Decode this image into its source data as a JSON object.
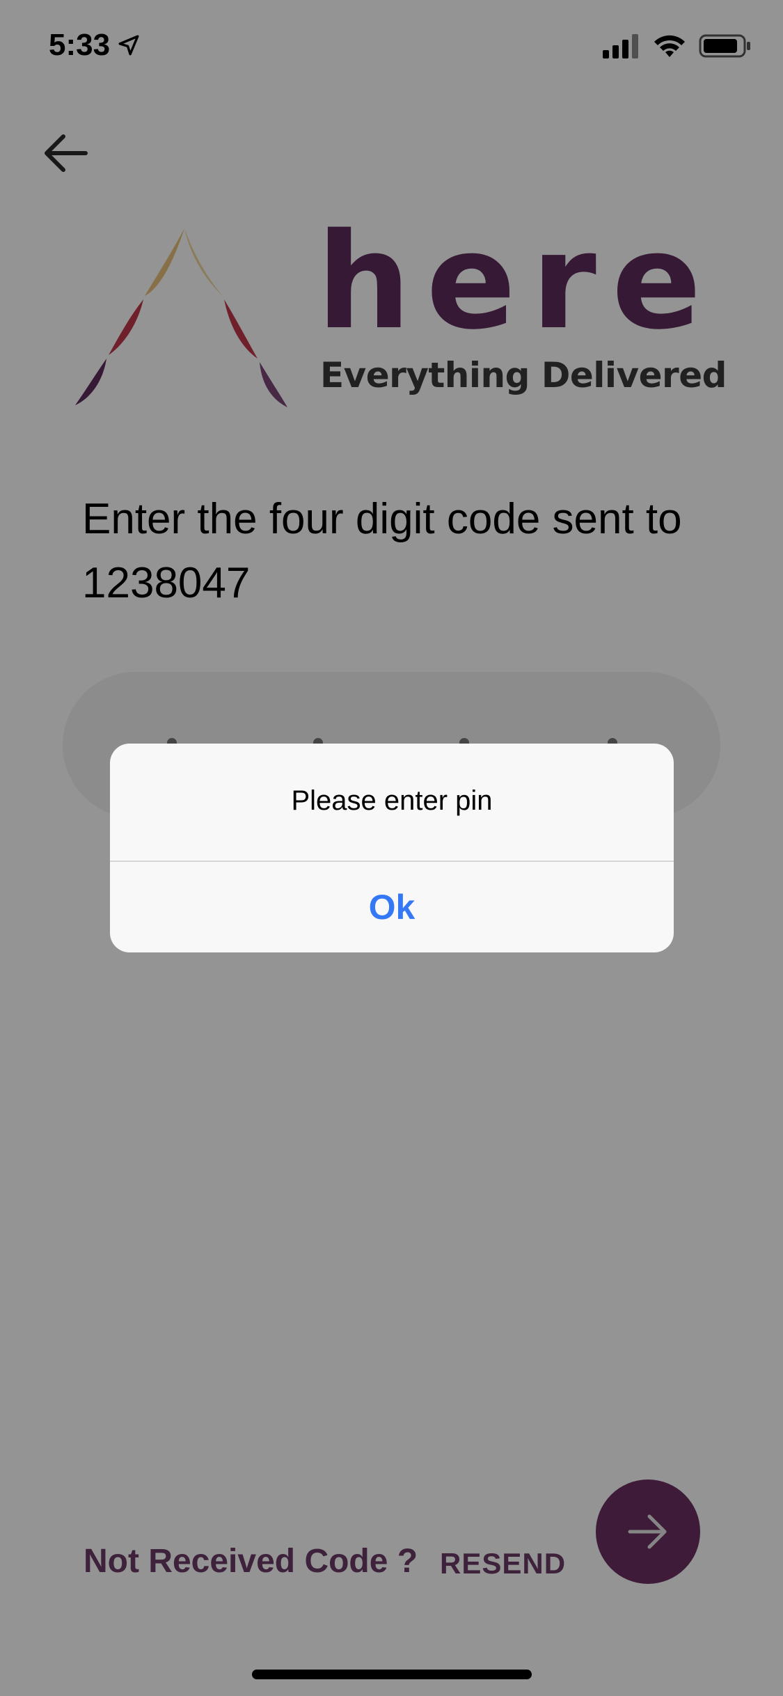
{
  "status_bar": {
    "time": "5:33",
    "location_icon": "location-arrow-icon",
    "signal_icon": "cellular-signal-icon",
    "wifi_icon": "wifi-icon",
    "battery_icon": "battery-icon"
  },
  "navigation": {
    "back_icon": "arrow-left-icon"
  },
  "logo": {
    "word": "here",
    "tagline": "Everything Delivered",
    "brand_color": "#5e2c5a"
  },
  "verification": {
    "prompt_line1": "Enter the four digit code sent to",
    "prompt_line2": "1238047"
  },
  "footer": {
    "not_received": "Not Received Code ?",
    "resend": "RESEND",
    "next_icon": "arrow-right-icon"
  },
  "alert": {
    "message": "Please enter pin",
    "ok_label": "Ok",
    "accent": "#3478f6"
  }
}
